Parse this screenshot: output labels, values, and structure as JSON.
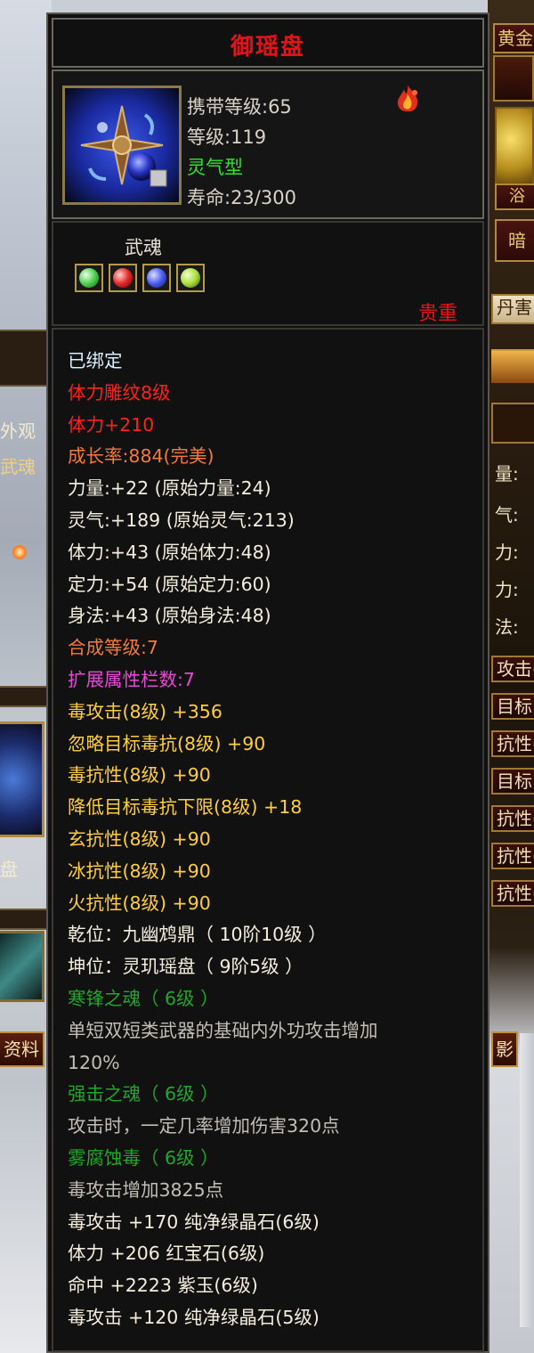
{
  "background": {
    "left_tabs": [
      "外观",
      "武魂"
    ],
    "left_item_label": "盘",
    "left_button_label": "资料",
    "right_tab_top": "黄金",
    "right_tab_2": "浴",
    "right_tab_3": "暗",
    "right_banner": "丹害",
    "right_stat_labels": [
      "量:",
      "气:",
      "力:",
      "力:",
      "法:"
    ],
    "right_skill_rows": [
      "攻击(",
      "目标",
      "抗性(",
      "目标",
      "抗性(",
      "抗性(",
      "抗性("
    ],
    "right_button_label": "影"
  },
  "item": {
    "name": "御瑶盘",
    "icon": "yuyaopan-artifact-icon",
    "carry_level": "携带等级:65",
    "level": "等级:119",
    "type": "灵气型",
    "durability": "寿命:23/300",
    "soul_label": "武魂",
    "soul_gems": [
      {
        "name": "green-soul-gem",
        "color": "#4bd14b"
      },
      {
        "name": "red-soul-gem",
        "color": "#e52626"
      },
      {
        "name": "blue-soul-gem",
        "color": "#4a5cf0"
      },
      {
        "name": "yellow-green-soul-gem",
        "color": "#a8e03a"
      }
    ],
    "rarity": "贵重"
  },
  "stats": [
    {
      "text": "已绑定",
      "color": "cyan"
    },
    {
      "text": "体力雕纹8级",
      "color": "red"
    },
    {
      "text": "体力+210",
      "color": "red"
    },
    {
      "text": "成长率:884(完美)",
      "color": "orange"
    },
    {
      "text": "力量:+22 (原始力量:24)",
      "color": "light"
    },
    {
      "text": "灵气:+189 (原始灵气:213)",
      "color": "light"
    },
    {
      "text": "体力:+43 (原始体力:48)",
      "color": "light"
    },
    {
      "text": "定力:+54 (原始定力:60)",
      "color": "light"
    },
    {
      "text": "身法:+43 (原始身法:48)",
      "color": "light"
    },
    {
      "text": "合成等级:7",
      "color": "orange"
    },
    {
      "text": "扩展属性栏数:7",
      "color": "pink"
    },
    {
      "text": "毒攻击(8级) +356",
      "color": "yellow"
    },
    {
      "text": "忽略目标毒抗(8级) +90",
      "color": "yellow"
    },
    {
      "text": "毒抗性(8级) +90",
      "color": "yellow"
    },
    {
      "text": "降低目标毒抗下限(8级) +18",
      "color": "yellow"
    },
    {
      "text": "玄抗性(8级) +90",
      "color": "yellow"
    },
    {
      "text": "冰抗性(8级) +90",
      "color": "yellow"
    },
    {
      "text": "火抗性(8级) +90",
      "color": "yellow"
    },
    {
      "text": "乾位：九幽鸩鼎（ 10阶10级 ）",
      "color": "light"
    },
    {
      "text": "坤位：灵玑瑶盘（ 9阶5级 ）",
      "color": "light"
    },
    {
      "text": "寒锋之魂（ 6级 ）",
      "color": "green"
    },
    {
      "text": "单短双短类武器的基础内外功攻击增加",
      "color": "gray"
    },
    {
      "text": "120%",
      "color": "gray"
    },
    {
      "text": "强击之魂（ 6级 ）",
      "color": "green"
    },
    {
      "text": "攻击时，一定几率增加伤害320点",
      "color": "gray"
    },
    {
      "text": "雾腐蚀毒（ 6级 ）",
      "color": "green"
    },
    {
      "text": "毒攻击增加3825点",
      "color": "gray"
    },
    {
      "text": "毒攻击 +170 纯净绿晶石(6级)",
      "color": "light"
    },
    {
      "text": "体力 +206 红宝石(6级)",
      "color": "light"
    },
    {
      "text": "命中 +2223 紫玉(6级)",
      "color": "light"
    },
    {
      "text": "毒攻击 +120 纯净绿晶石(5级)",
      "color": "light"
    }
  ]
}
